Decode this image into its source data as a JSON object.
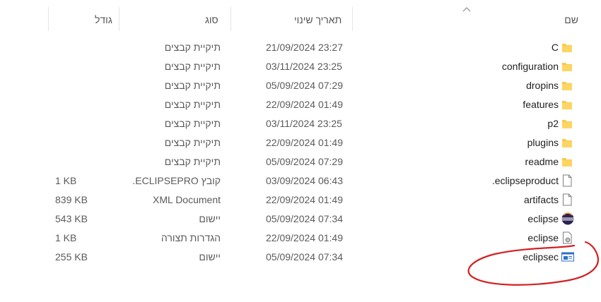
{
  "columns": {
    "name": "שם",
    "modified": "תאריך שינוי",
    "type": "סוג",
    "size": "גודל"
  },
  "files": [
    {
      "name": "C",
      "modified": "21/09/2024 23:27",
      "type": "תיקיית קבצים",
      "size": "",
      "icon": "folder-icon"
    },
    {
      "name": "configuration",
      "modified": "03/11/2024 23:25",
      "type": "תיקיית קבצים",
      "size": "",
      "icon": "folder-icon"
    },
    {
      "name": "dropins",
      "modified": "05/09/2024 07:29",
      "type": "תיקיית קבצים",
      "size": "",
      "icon": "folder-icon"
    },
    {
      "name": "features",
      "modified": "22/09/2024 01:49",
      "type": "תיקיית קבצים",
      "size": "",
      "icon": "folder-icon"
    },
    {
      "name": "p2",
      "modified": "03/11/2024 23:25",
      "type": "תיקיית קבצים",
      "size": "",
      "icon": "folder-icon"
    },
    {
      "name": "plugins",
      "modified": "22/09/2024 01:49",
      "type": "תיקיית קבצים",
      "size": "",
      "icon": "folder-icon"
    },
    {
      "name": "readme",
      "modified": "05/09/2024 07:29",
      "type": "תיקיית קבצים",
      "size": "",
      "icon": "folder-icon"
    },
    {
      "name": ".eclipseproduct",
      "modified": "03/09/2024 06:43",
      "type": "קובץ ECLIPSEPRO...",
      "size": "1 KB",
      "icon": "file-icon"
    },
    {
      "name": "artifacts",
      "modified": "22/09/2024 01:49",
      "type": "XML Document",
      "size": "839 KB",
      "icon": "file-icon"
    },
    {
      "name": "eclipse",
      "modified": "05/09/2024 07:34",
      "type": "יישום",
      "size": "543 KB",
      "icon": "eclipse-app-icon"
    },
    {
      "name": "eclipse",
      "modified": "22/09/2024 01:49",
      "type": "הגדרות תצורה",
      "size": "1 KB",
      "icon": "config-file-icon"
    },
    {
      "name": "eclipsec",
      "modified": "05/09/2024 07:34",
      "type": "יישום",
      "size": "255 KB",
      "icon": "console-app-icon"
    }
  ],
  "colors": {
    "folder": "#f8c94a",
    "annotation": "#d42020",
    "eclipse_purple": "#2c2255",
    "selection": "#e5f3ff"
  }
}
